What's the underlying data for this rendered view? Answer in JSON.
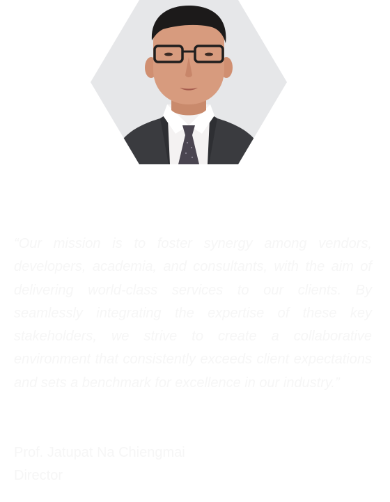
{
  "portrait": {
    "alt": "",
    "icon": "person-portrait"
  },
  "quote": {
    "open_mark": "“",
    "text": "Our mission is to foster synergy among vendors, developers, academia, and consultants, with the aim of delivering world-class services to our clients. By seamlessly integrating the expertise of these key stakeholders, we strive to create a collaborative environment that consistently exceeds client expectations and sets a benchmark for excellence in our industry.",
    "close_mark": "”"
  },
  "person": {
    "name": "Prof. Jatupat Na Chiengmai",
    "title": "Director"
  },
  "colors": {
    "page_background": "#ffffff",
    "text": "#f6f6f6",
    "portrait_background": "#e6e7e9",
    "suit": "#3a3b3f",
    "shirt": "#f4f2f2",
    "tie": "#4a4550",
    "skin": "#d79b7e",
    "hair": "#1c1a1a"
  }
}
